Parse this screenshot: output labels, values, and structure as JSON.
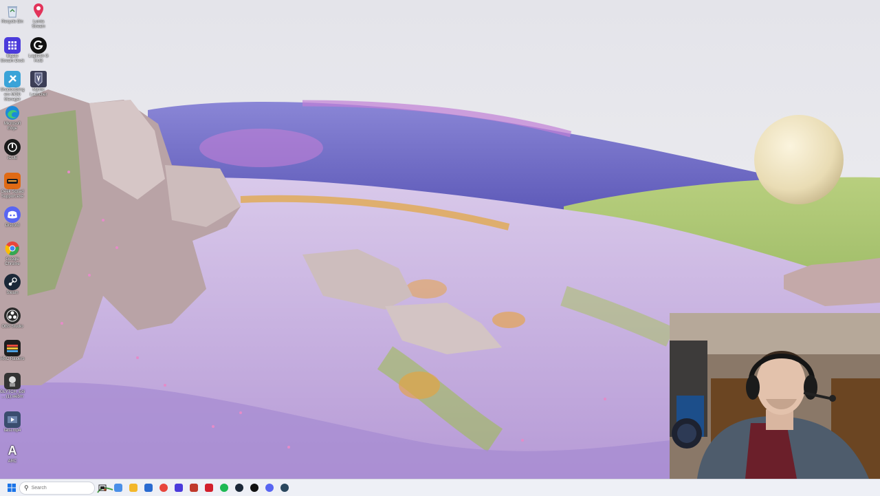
{
  "desktop": {
    "icons": [
      {
        "label": "Recycle Bin",
        "icon": "recycle-bin-icon",
        "color": "#5a7fb0"
      },
      {
        "label": "Elgato Stream Deck",
        "icon": "stream-deck-icon",
        "color": "#4b3bdb"
      },
      {
        "label": "Shadowbringers MOD Manager",
        "icon": "mod-manager-icon",
        "color": "#3aa3d8"
      },
      {
        "label": "Microsoft Edge",
        "icon": "edge-icon",
        "color": "#1c8ad8"
      },
      {
        "label": "iCUE",
        "icon": "icue-icon",
        "color": "#1a1a1a"
      },
      {
        "label": "Geek Squad Support.exe",
        "icon": "geek-squad-icon",
        "color": "#e06a14"
      },
      {
        "label": "Discord",
        "icon": "discord-icon",
        "color": "#5865f2"
      },
      {
        "label": "Google Chrome",
        "icon": "chrome-icon",
        "color": "#e8453c"
      },
      {
        "label": "Steam",
        "icon": "steam-icon",
        "color": "#1b2838"
      },
      {
        "label": "OBS Studio",
        "icon": "obs-icon",
        "color": "#2b2b2b"
      },
      {
        "label": "ARC Raiders",
        "icon": "arc-raiders-icon",
        "color": "#1e1e1e"
      },
      {
        "label": "GLYTCH_Edi... (1).webm",
        "icon": "video-file-icon",
        "color": "#333333"
      },
      {
        "label": "tatsi.mp4",
        "icon": "video-file-icon",
        "color": "#3a4d6e"
      },
      {
        "label": "ARC",
        "icon": "arc-icon",
        "color": "#2a2a2a"
      },
      {
        "label": "Lumia Stream",
        "icon": "lumia-stream-icon",
        "color": "#e2335a"
      },
      {
        "label": "Logitech G HUB",
        "icon": "logitech-g-hub-icon",
        "color": "#111111"
      },
      {
        "label": "Mythic Launcher",
        "icon": "mythic-launcher-icon",
        "color": "#3c3e56"
      }
    ]
  },
  "taskbar": {
    "search_placeholder": "Search",
    "apps": [
      {
        "name": "copilot-icon",
        "color": "#4a8fe8"
      },
      {
        "name": "file-explorer-icon",
        "color": "#f3b72b"
      },
      {
        "name": "media-app-icon",
        "color": "#2a6bd1"
      },
      {
        "name": "chrome-icon",
        "color": "#e8453c"
      },
      {
        "name": "stream-deck-icon",
        "color": "#4b3bdb"
      },
      {
        "name": "capture-app-icon",
        "color": "#c0392b"
      },
      {
        "name": "adobe-app-icon",
        "color": "#d21f2b"
      },
      {
        "name": "spotify-icon",
        "color": "#1db954"
      },
      {
        "name": "steam-icon",
        "color": "#1b2838"
      },
      {
        "name": "logitech-g-hub-icon",
        "color": "#111111"
      },
      {
        "name": "discord-icon",
        "color": "#5865f2"
      },
      {
        "name": "steam-icon",
        "color": "#2a475e"
      }
    ]
  }
}
